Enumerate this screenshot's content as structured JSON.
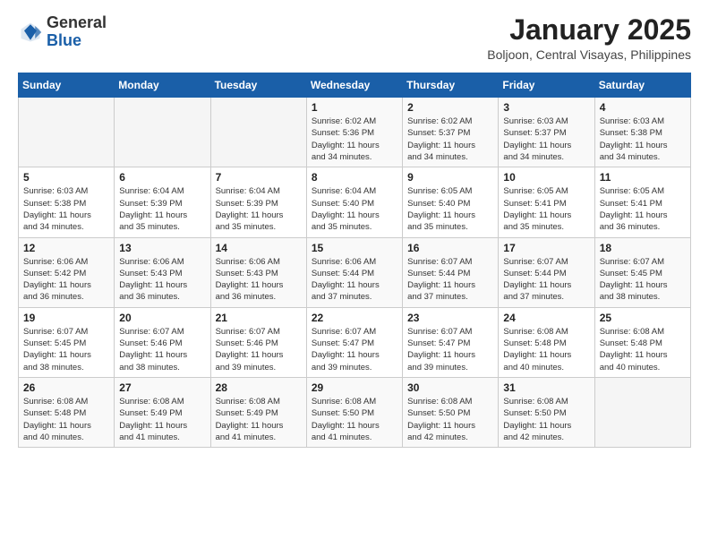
{
  "header": {
    "logo_general": "General",
    "logo_blue": "Blue",
    "month_title": "January 2025",
    "location": "Boljoon, Central Visayas, Philippines"
  },
  "weekdays": [
    "Sunday",
    "Monday",
    "Tuesday",
    "Wednesday",
    "Thursday",
    "Friday",
    "Saturday"
  ],
  "weeks": [
    [
      {
        "day": "",
        "info": ""
      },
      {
        "day": "",
        "info": ""
      },
      {
        "day": "",
        "info": ""
      },
      {
        "day": "1",
        "info": "Sunrise: 6:02 AM\nSunset: 5:36 PM\nDaylight: 11 hours\nand 34 minutes."
      },
      {
        "day": "2",
        "info": "Sunrise: 6:02 AM\nSunset: 5:37 PM\nDaylight: 11 hours\nand 34 minutes."
      },
      {
        "day": "3",
        "info": "Sunrise: 6:03 AM\nSunset: 5:37 PM\nDaylight: 11 hours\nand 34 minutes."
      },
      {
        "day": "4",
        "info": "Sunrise: 6:03 AM\nSunset: 5:38 PM\nDaylight: 11 hours\nand 34 minutes."
      }
    ],
    [
      {
        "day": "5",
        "info": "Sunrise: 6:03 AM\nSunset: 5:38 PM\nDaylight: 11 hours\nand 34 minutes."
      },
      {
        "day": "6",
        "info": "Sunrise: 6:04 AM\nSunset: 5:39 PM\nDaylight: 11 hours\nand 35 minutes."
      },
      {
        "day": "7",
        "info": "Sunrise: 6:04 AM\nSunset: 5:39 PM\nDaylight: 11 hours\nand 35 minutes."
      },
      {
        "day": "8",
        "info": "Sunrise: 6:04 AM\nSunset: 5:40 PM\nDaylight: 11 hours\nand 35 minutes."
      },
      {
        "day": "9",
        "info": "Sunrise: 6:05 AM\nSunset: 5:40 PM\nDaylight: 11 hours\nand 35 minutes."
      },
      {
        "day": "10",
        "info": "Sunrise: 6:05 AM\nSunset: 5:41 PM\nDaylight: 11 hours\nand 35 minutes."
      },
      {
        "day": "11",
        "info": "Sunrise: 6:05 AM\nSunset: 5:41 PM\nDaylight: 11 hours\nand 36 minutes."
      }
    ],
    [
      {
        "day": "12",
        "info": "Sunrise: 6:06 AM\nSunset: 5:42 PM\nDaylight: 11 hours\nand 36 minutes."
      },
      {
        "day": "13",
        "info": "Sunrise: 6:06 AM\nSunset: 5:43 PM\nDaylight: 11 hours\nand 36 minutes."
      },
      {
        "day": "14",
        "info": "Sunrise: 6:06 AM\nSunset: 5:43 PM\nDaylight: 11 hours\nand 36 minutes."
      },
      {
        "day": "15",
        "info": "Sunrise: 6:06 AM\nSunset: 5:44 PM\nDaylight: 11 hours\nand 37 minutes."
      },
      {
        "day": "16",
        "info": "Sunrise: 6:07 AM\nSunset: 5:44 PM\nDaylight: 11 hours\nand 37 minutes."
      },
      {
        "day": "17",
        "info": "Sunrise: 6:07 AM\nSunset: 5:44 PM\nDaylight: 11 hours\nand 37 minutes."
      },
      {
        "day": "18",
        "info": "Sunrise: 6:07 AM\nSunset: 5:45 PM\nDaylight: 11 hours\nand 38 minutes."
      }
    ],
    [
      {
        "day": "19",
        "info": "Sunrise: 6:07 AM\nSunset: 5:45 PM\nDaylight: 11 hours\nand 38 minutes."
      },
      {
        "day": "20",
        "info": "Sunrise: 6:07 AM\nSunset: 5:46 PM\nDaylight: 11 hours\nand 38 minutes."
      },
      {
        "day": "21",
        "info": "Sunrise: 6:07 AM\nSunset: 5:46 PM\nDaylight: 11 hours\nand 39 minutes."
      },
      {
        "day": "22",
        "info": "Sunrise: 6:07 AM\nSunset: 5:47 PM\nDaylight: 11 hours\nand 39 minutes."
      },
      {
        "day": "23",
        "info": "Sunrise: 6:07 AM\nSunset: 5:47 PM\nDaylight: 11 hours\nand 39 minutes."
      },
      {
        "day": "24",
        "info": "Sunrise: 6:08 AM\nSunset: 5:48 PM\nDaylight: 11 hours\nand 40 minutes."
      },
      {
        "day": "25",
        "info": "Sunrise: 6:08 AM\nSunset: 5:48 PM\nDaylight: 11 hours\nand 40 minutes."
      }
    ],
    [
      {
        "day": "26",
        "info": "Sunrise: 6:08 AM\nSunset: 5:48 PM\nDaylight: 11 hours\nand 40 minutes."
      },
      {
        "day": "27",
        "info": "Sunrise: 6:08 AM\nSunset: 5:49 PM\nDaylight: 11 hours\nand 41 minutes."
      },
      {
        "day": "28",
        "info": "Sunrise: 6:08 AM\nSunset: 5:49 PM\nDaylight: 11 hours\nand 41 minutes."
      },
      {
        "day": "29",
        "info": "Sunrise: 6:08 AM\nSunset: 5:50 PM\nDaylight: 11 hours\nand 41 minutes."
      },
      {
        "day": "30",
        "info": "Sunrise: 6:08 AM\nSunset: 5:50 PM\nDaylight: 11 hours\nand 42 minutes."
      },
      {
        "day": "31",
        "info": "Sunrise: 6:08 AM\nSunset: 5:50 PM\nDaylight: 11 hours\nand 42 minutes."
      },
      {
        "day": "",
        "info": ""
      }
    ]
  ]
}
